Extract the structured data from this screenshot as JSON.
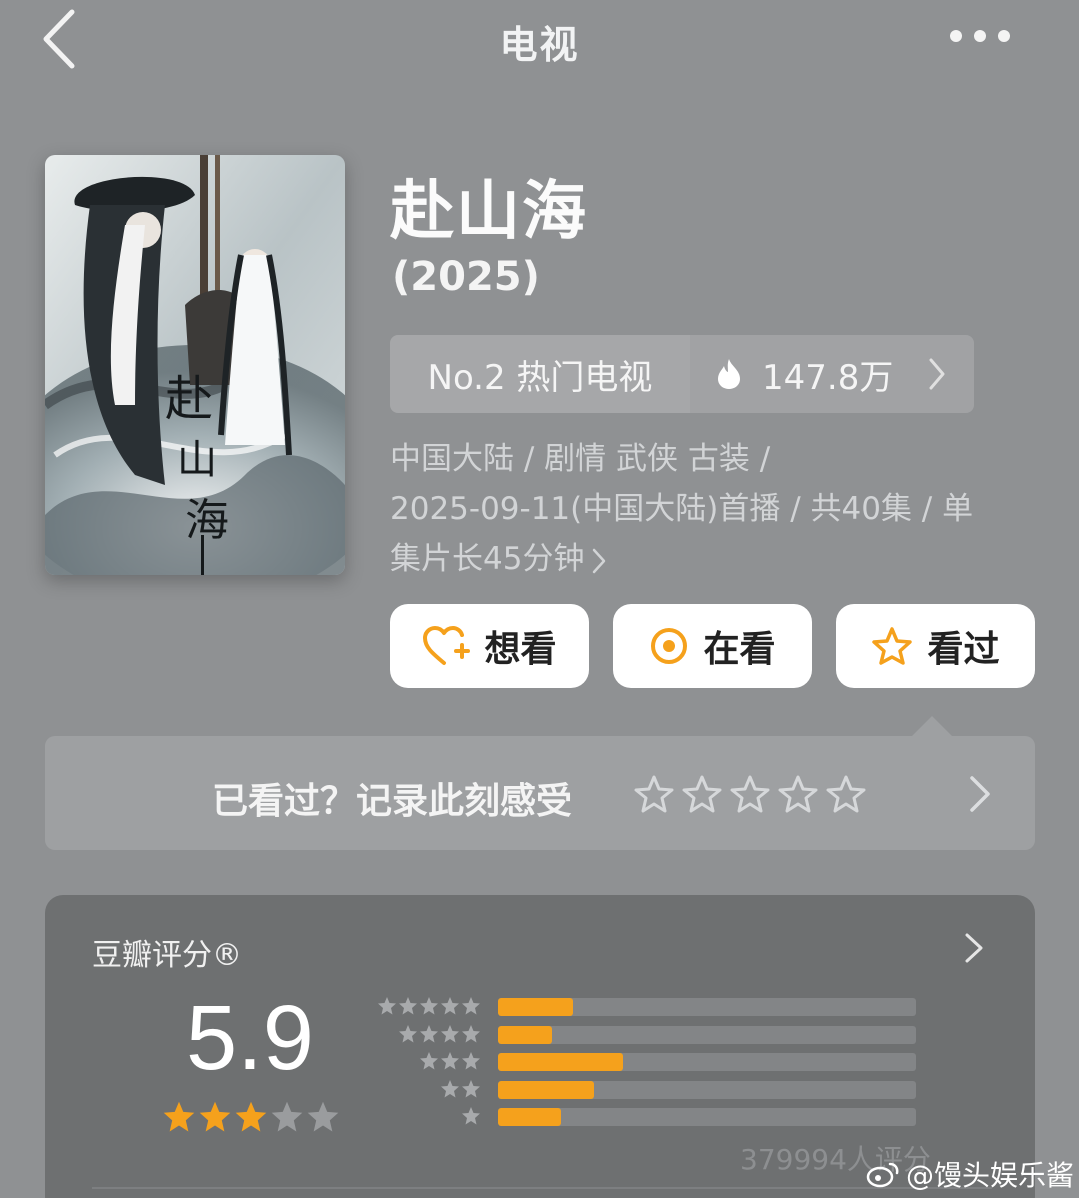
{
  "topbar": {
    "title": "电视"
  },
  "show": {
    "title": "赴山海",
    "year": "(2025)"
  },
  "rank": {
    "label": "No.2 热门电视",
    "heat": "147.8万"
  },
  "meta": {
    "line1": "中国大陆 / 剧情 武侠 古装 /",
    "line2": "2025-09-11(中国大陆)首播 / 共40集 / 单",
    "line3": "集片长45分钟"
  },
  "actions": {
    "want": "想看",
    "watching": "在看",
    "watched": "看过"
  },
  "record": {
    "prompt": "已看过？记录此刻感受"
  },
  "rating": {
    "label": "豆瓣评分®",
    "score": "5.9",
    "star_level": 3,
    "distribution": [
      {
        "stars": 5,
        "fraction": 0.18
      },
      {
        "stars": 4,
        "fraction": 0.13
      },
      {
        "stars": 3,
        "fraction": 0.3
      },
      {
        "stars": 2,
        "fraction": 0.23
      },
      {
        "stars": 1,
        "fraction": 0.15
      }
    ],
    "count": "379994人评分"
  },
  "watermark": "@馒头娱乐酱",
  "colors": {
    "accent": "#f5a11c",
    "background": "#8f9193",
    "card": "#6e7071"
  }
}
